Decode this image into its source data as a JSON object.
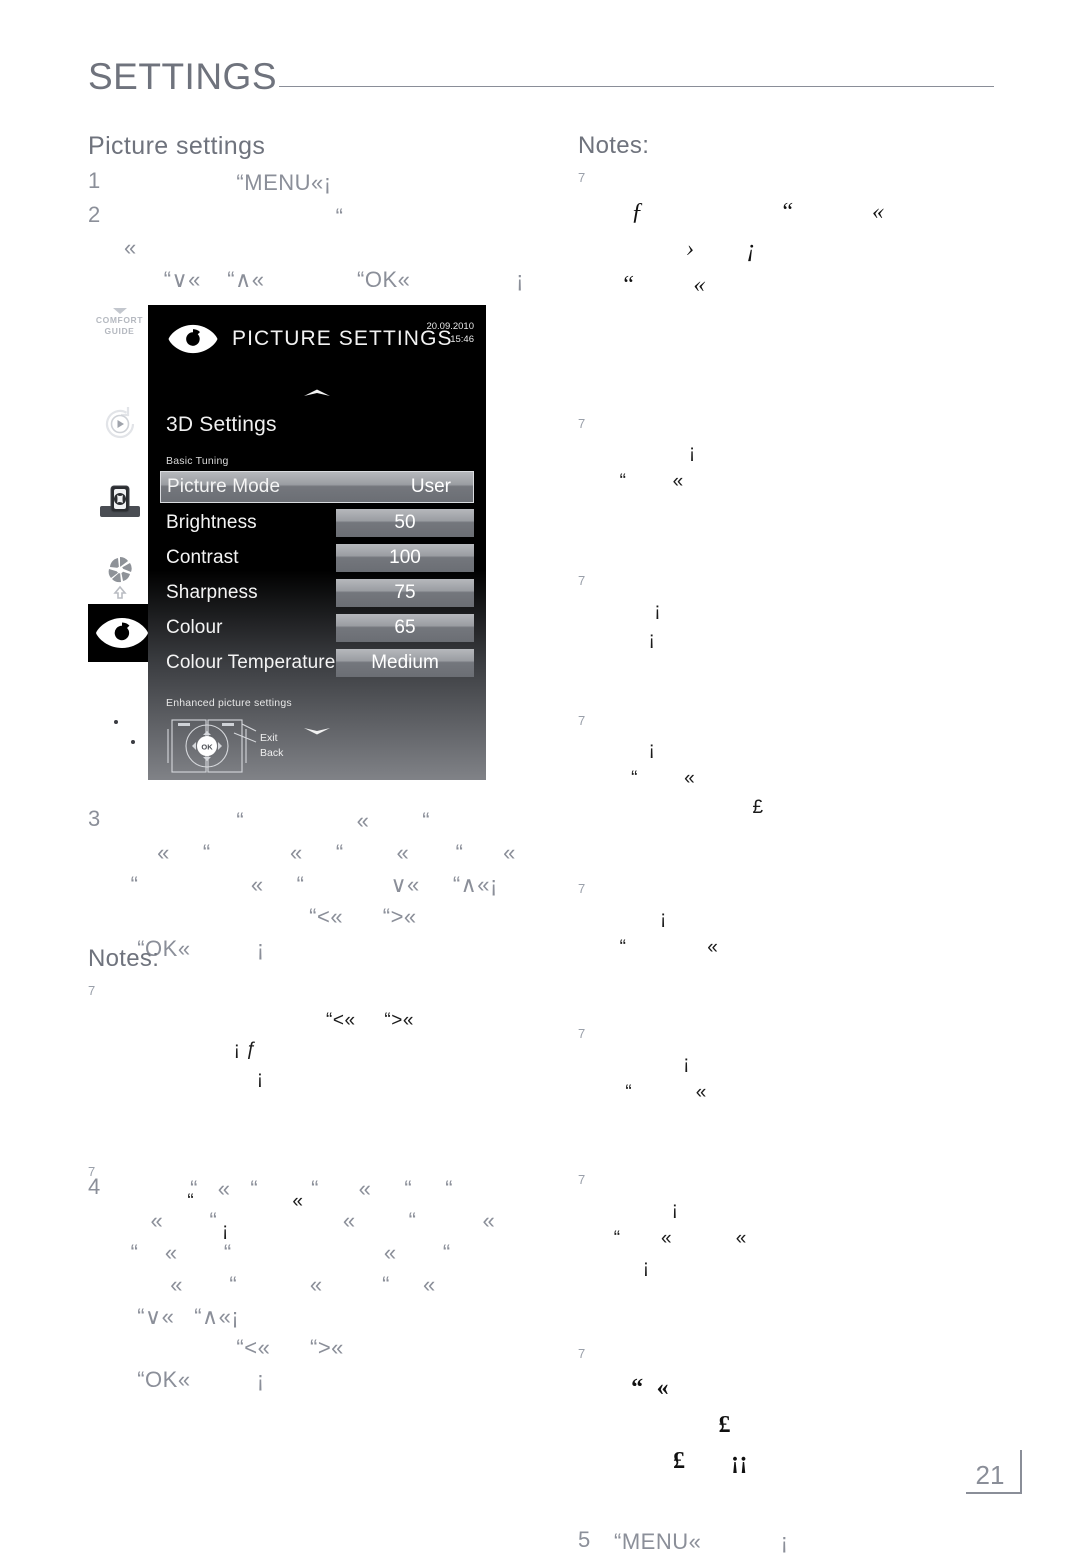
{
  "header": {
    "title": "SETTINGS"
  },
  "left_column": {
    "section_heading": "Picture settings",
    "steps": [
      {
        "number": "1",
        "text": "                 “MENU«¡"
      },
      {
        "number": "2",
        "text": "                                “                                     «\n      “∨«    “∧«              “OK«                ¡\n   “                     «                  ¡"
      },
      {
        "number": "3",
        "text": "                 “                 «        “\n     «     “            «     “        «       “      «\n “                 «     “             ∨«     “∧«¡\n                            “<«      “>«\n  “OK«          ¡"
      },
      {
        "number": "4",
        "text": "          “   «   “        “      «     “     “\n    «       “                   «        “          «\n “    «       “                       «       “\n       «       “           «         “     «\n  “∨«   “∧«¡\n                 “<«      “>«\n  “OK«          ¡"
      }
    ],
    "notes_heading": "Notes:",
    "notes": [
      {
        "marker": "7",
        "text": "                              “<«     “>«\n                    ¡ ƒ\n                        ¡"
      },
      {
        "marker": "7",
        "text": "      “                 «\n                  ¡"
      }
    ]
  },
  "right_column": {
    "notes_heading": "Notes:",
    "notes": [
      {
        "marker": "7",
        "text": "ƒ                     “            «\n            ›        ¡\n  “         «"
      },
      {
        "marker": "7",
        "text": "          ¡\n  “        «"
      },
      {
        "marker": "7",
        "text": "    ¡\n       ¡"
      },
      {
        "marker": "7",
        "text": "   ¡\n    “        «\n                         £"
      },
      {
        "marker": "7",
        "text": "     ¡\n  “              «"
      },
      {
        "marker": "7",
        "text": "         ¡\n   “           «"
      },
      {
        "marker": "7",
        "text": "       ¡\n “       «           «\n      ¡"
      },
      {
        "marker": "7",
        "text": "“  «\n                 £\n          £       ¡¡"
      }
    ],
    "step5": {
      "number": "5",
      "text": "“MENU«            ¡"
    }
  },
  "tv_figure": {
    "sidebar": {
      "comfort_label_line1": "COMFORT",
      "comfort_label_line2": "GUIDE"
    },
    "header": {
      "title": "PICTURE SETTINGS",
      "date": "20.09.2010",
      "time": "15:46"
    },
    "submenu_title": "3D Settings",
    "group_basic": "Basic Tuning",
    "group_enhanced": "Enhanced picture settings",
    "rows": [
      {
        "label": "Picture Mode",
        "value": "User",
        "selected": true
      },
      {
        "label": "Brightness",
        "value": "50",
        "selected": false
      },
      {
        "label": "Contrast",
        "value": "100",
        "selected": false
      },
      {
        "label": "Sharpness",
        "value": "75",
        "selected": false
      },
      {
        "label": "Colour",
        "value": "65",
        "selected": false
      },
      {
        "label": "Colour Temperature",
        "value": "Medium",
        "selected": false
      }
    ],
    "navpad": {
      "ok_label": "OK",
      "exit_label": "Exit",
      "back_label": "Back"
    }
  },
  "footer": {
    "page_number": "21"
  },
  "colors": {
    "page_background": "#ffffff",
    "heading_gray": "#6f737d",
    "rule_gray": "#8a8e98",
    "tv_background": "#000000",
    "chip_light": "#b6b8bc",
    "chip_dark": "#6b6e74",
    "body_text": "#1b1b1b"
  }
}
